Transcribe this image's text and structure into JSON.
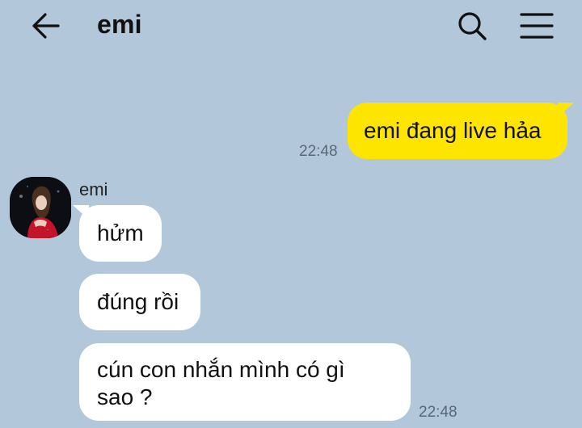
{
  "header": {
    "back_icon": "arrow-left-icon",
    "title": "emi",
    "search_icon": "search-icon",
    "menu_icon": "hamburger-menu-icon"
  },
  "messages": [
    {
      "direction": "outgoing",
      "text": "emi đang live hảa",
      "time": "22:48"
    },
    {
      "direction": "incoming",
      "sender": "emi",
      "text": "hửm"
    },
    {
      "direction": "incoming",
      "text": "đúng rồi"
    },
    {
      "direction": "incoming",
      "lines": [
        "cún con nhắn mình có gì",
        "sao ?"
      ],
      "time": "22:48"
    }
  ],
  "colors": {
    "background": "#b2c7d9",
    "outgoing_bubble": "#fee500",
    "incoming_bubble": "#ffffff",
    "timestamp": "#596878"
  }
}
